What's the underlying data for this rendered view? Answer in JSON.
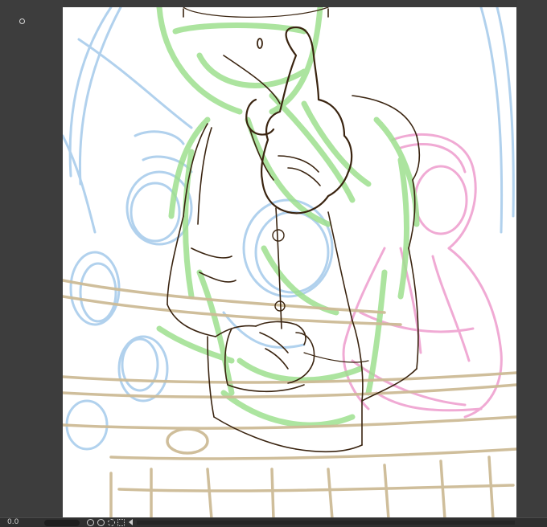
{
  "app": {
    "statusbar": {
      "zoom_value": "0.0"
    },
    "icons": {
      "brush_cursor": "brush-cursor-icon",
      "fit": "zoom-fit-icon",
      "actual": "zoom-actual-icon",
      "rotate": "rotate-view-icon",
      "grid": "grid-icon",
      "scroll_left": "chevron-left-icon"
    },
    "colors": {
      "ui_background": "#3b3b3b",
      "canvas": "#ffffff",
      "sketch_green": "#9ee08f",
      "sketch_blue": "#a9cdec",
      "sketch_pink": "#f0a6d2",
      "sketch_tan": "#cdbb96",
      "lineart": "#3a2410"
    }
  }
}
